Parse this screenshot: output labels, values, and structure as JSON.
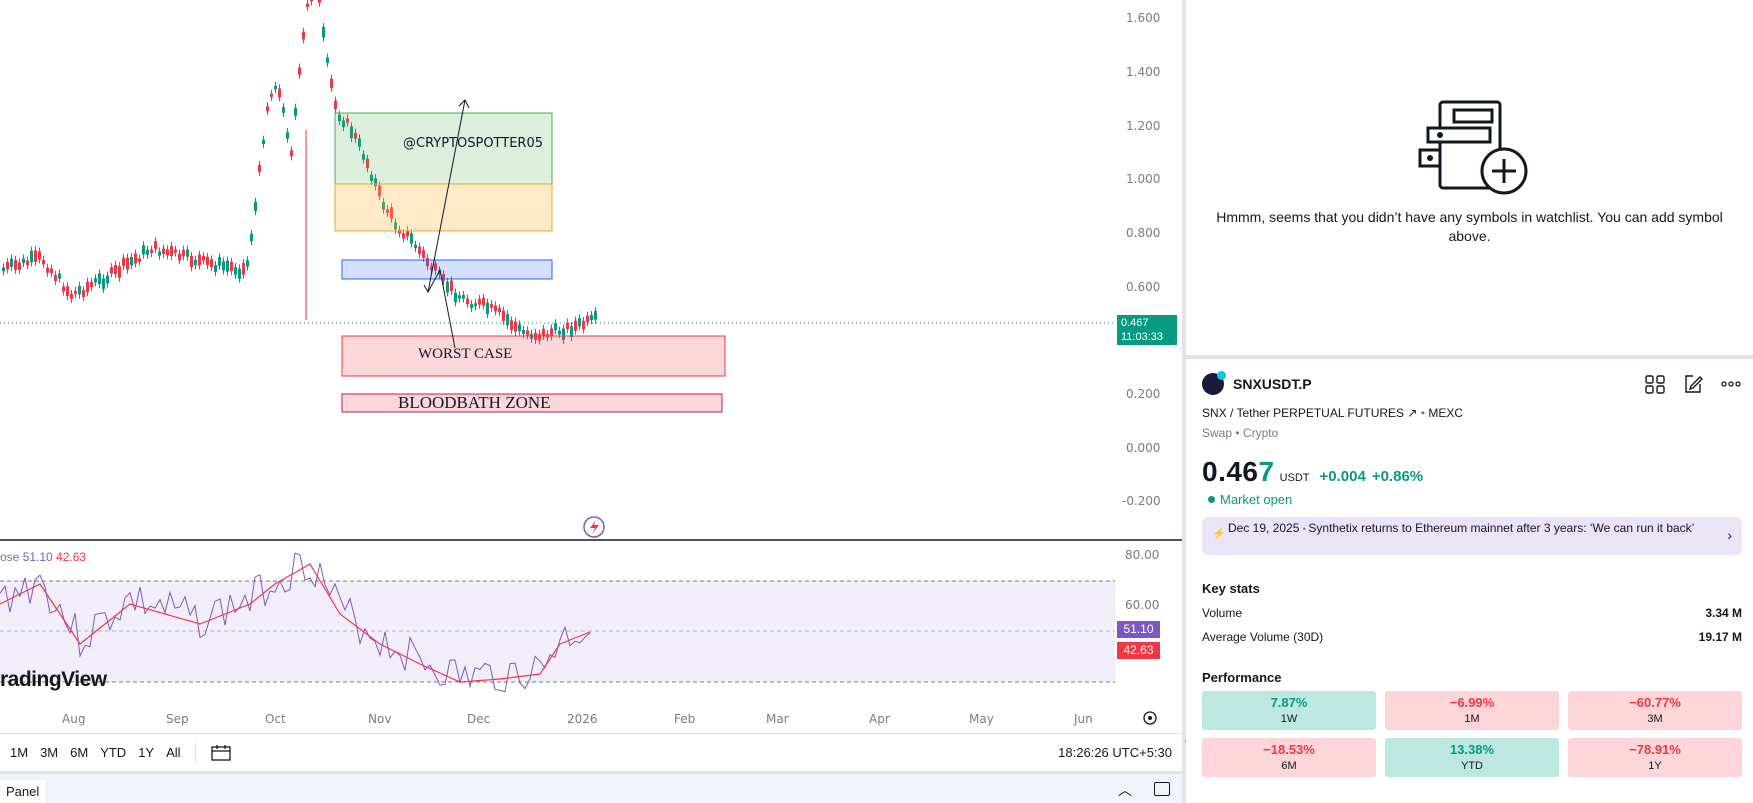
{
  "chart": {
    "price_axis": [
      "1.600",
      "1.400",
      "1.200",
      "1.000",
      "0.800",
      "0.600",
      "0.200",
      "0.000",
      "-0.200"
    ],
    "last_price_tag": "0.467",
    "countdown_tag": "11:03:33",
    "annotations": {
      "watermark_text": "@CRYPTOSPOTTER05",
      "worst_case": "WORST CASE",
      "bloodbath": "BLOODBATH ZONE"
    },
    "time_axis": [
      "Aug",
      "Sep",
      "Oct",
      "Nov",
      "Dec",
      "2026",
      "Feb",
      "Mar",
      "Apr",
      "May",
      "Jun"
    ]
  },
  "rsi": {
    "legend_prefix": "ose",
    "value_rsi": "51.10",
    "value_ma": "42.63",
    "axis": [
      "80.00",
      "60.00"
    ],
    "tag_rsi": "51.10",
    "tag_ma": "42.63"
  },
  "branding": {
    "tradingview": "radingView"
  },
  "toolbar": {
    "ranges": [
      "1M",
      "3M",
      "6M",
      "YTD",
      "1Y",
      "All"
    ],
    "clock": "18:26:26 UTC+5:30",
    "panel_tab": "Panel"
  },
  "watchlist": {
    "empty_message": "Hmmm, seems that you didn’t have any symbols in watchlist. You can add symbol above."
  },
  "symbol": {
    "ticker": "SNXUSDT.P",
    "description": "SNX / Tether PERPETUAL FUTURES",
    "exchange": "MEXC",
    "type": "Swap",
    "category": "Crypto",
    "price_main": "0.46",
    "price_last_digit": "7",
    "currency": "USDT",
    "change_abs": "+0.004",
    "change_pct": "+0.86%",
    "market_status": "Market open",
    "news_date": "Dec 19, 2025",
    "news_headline": "Synthetix returns to Ethereum mainnet after 3 years: ‘We can run it back’"
  },
  "key_stats": {
    "title": "Key stats",
    "volume_label": "Volume",
    "volume_value": "3.34 M",
    "avg_volume_label": "Average Volume (30D)",
    "avg_volume_value": "19.17 M"
  },
  "performance": {
    "title": "Performance",
    "cells": [
      {
        "value": "7.87%",
        "label": "1W",
        "trend": "pos"
      },
      {
        "value": "−6.99%",
        "label": "1M",
        "trend": "neg"
      },
      {
        "value": "−60.77%",
        "label": "3M",
        "trend": "neg"
      },
      {
        "value": "−18.53%",
        "label": "6M",
        "trend": "neg"
      },
      {
        "value": "13.38%",
        "label": "YTD",
        "trend": "pos"
      },
      {
        "value": "−78.91%",
        "label": "1Y",
        "trend": "neg"
      }
    ]
  },
  "colors": {
    "up": "#089981",
    "down": "#f23645",
    "rsi_line": "#7e57c2",
    "rsi_ma": "#f23645"
  }
}
